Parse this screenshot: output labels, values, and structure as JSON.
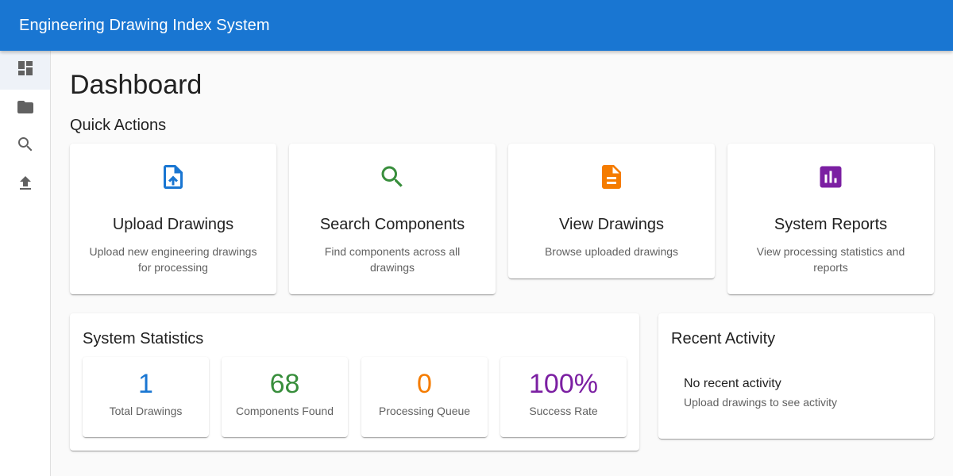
{
  "app": {
    "title": "Engineering Drawing Index System"
  },
  "sidebar": {
    "items": [
      {
        "icon": "dashboard-icon",
        "active": true
      },
      {
        "icon": "folder-icon",
        "active": false
      },
      {
        "icon": "search-icon",
        "active": false
      },
      {
        "icon": "upload-icon",
        "active": false
      }
    ]
  },
  "page": {
    "title": "Dashboard"
  },
  "quick_actions": {
    "title": "Quick Actions",
    "cards": [
      {
        "title": "Upload Drawings",
        "description": "Upload new engineering drawings for processing",
        "icon": "upload-file-icon",
        "color": "#1976d2"
      },
      {
        "title": "Search Components",
        "description": "Find components across all drawings",
        "icon": "search-icon",
        "color": "#388e3c"
      },
      {
        "title": "View Drawings",
        "description": "Browse uploaded drawings",
        "icon": "document-icon",
        "color": "#f57c00"
      },
      {
        "title": "System Reports",
        "description": "View processing statistics and reports",
        "icon": "bar-chart-icon",
        "color": "#7b1fa2"
      }
    ]
  },
  "statistics": {
    "title": "System Statistics",
    "items": [
      {
        "value": "1",
        "label": "Total Drawings",
        "color": "#1976d2"
      },
      {
        "value": "68",
        "label": "Components Found",
        "color": "#388e3c"
      },
      {
        "value": "0",
        "label": "Processing Queue",
        "color": "#f57c00"
      },
      {
        "value": "100%",
        "label": "Success Rate",
        "color": "#7b1fa2"
      }
    ]
  },
  "recent_activity": {
    "title": "Recent Activity",
    "empty_primary": "No recent activity",
    "empty_secondary": "Upload drawings to see activity"
  }
}
